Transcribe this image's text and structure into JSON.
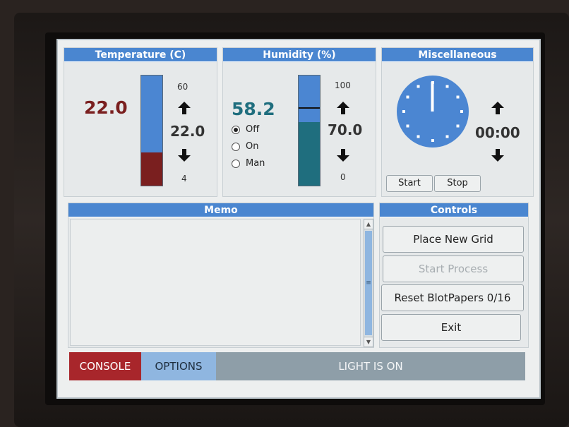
{
  "temperature": {
    "title": "Temperature (C)",
    "current": "22.0",
    "setpoint": "22.0",
    "max_label": "60",
    "min_label": "4",
    "fill_fraction": 0.3
  },
  "humidity": {
    "title": "Humidity (%)",
    "current": "58.2",
    "setpoint": "70.0",
    "max_label": "100",
    "min_label": "0",
    "fill_fraction": 0.58,
    "modes": [
      "Off",
      "On",
      "Man"
    ],
    "selected_mode": "Off"
  },
  "misc": {
    "title": "Miscellaneous",
    "timer": "00:00",
    "start_label": "Start",
    "stop_label": "Stop"
  },
  "memo": {
    "title": "Memo",
    "text": ""
  },
  "controls": {
    "title": "Controls",
    "place_grid_label": "Place New Grid",
    "start_process_label": "Start Process",
    "reset_label": "Reset BlotPapers 0/16",
    "exit_label": "Exit"
  },
  "tabs": {
    "console": "CONSOLE",
    "options": "OPTIONS",
    "status": "LIGHT IS ON"
  },
  "colors": {
    "header_blue": "#4a86d0",
    "temp_red": "#7a1f1f",
    "humidity_teal": "#1f6e7e",
    "console_tab": "#a8262b",
    "options_tab": "#8fb6e0",
    "status_bar": "#8e9ea8"
  }
}
